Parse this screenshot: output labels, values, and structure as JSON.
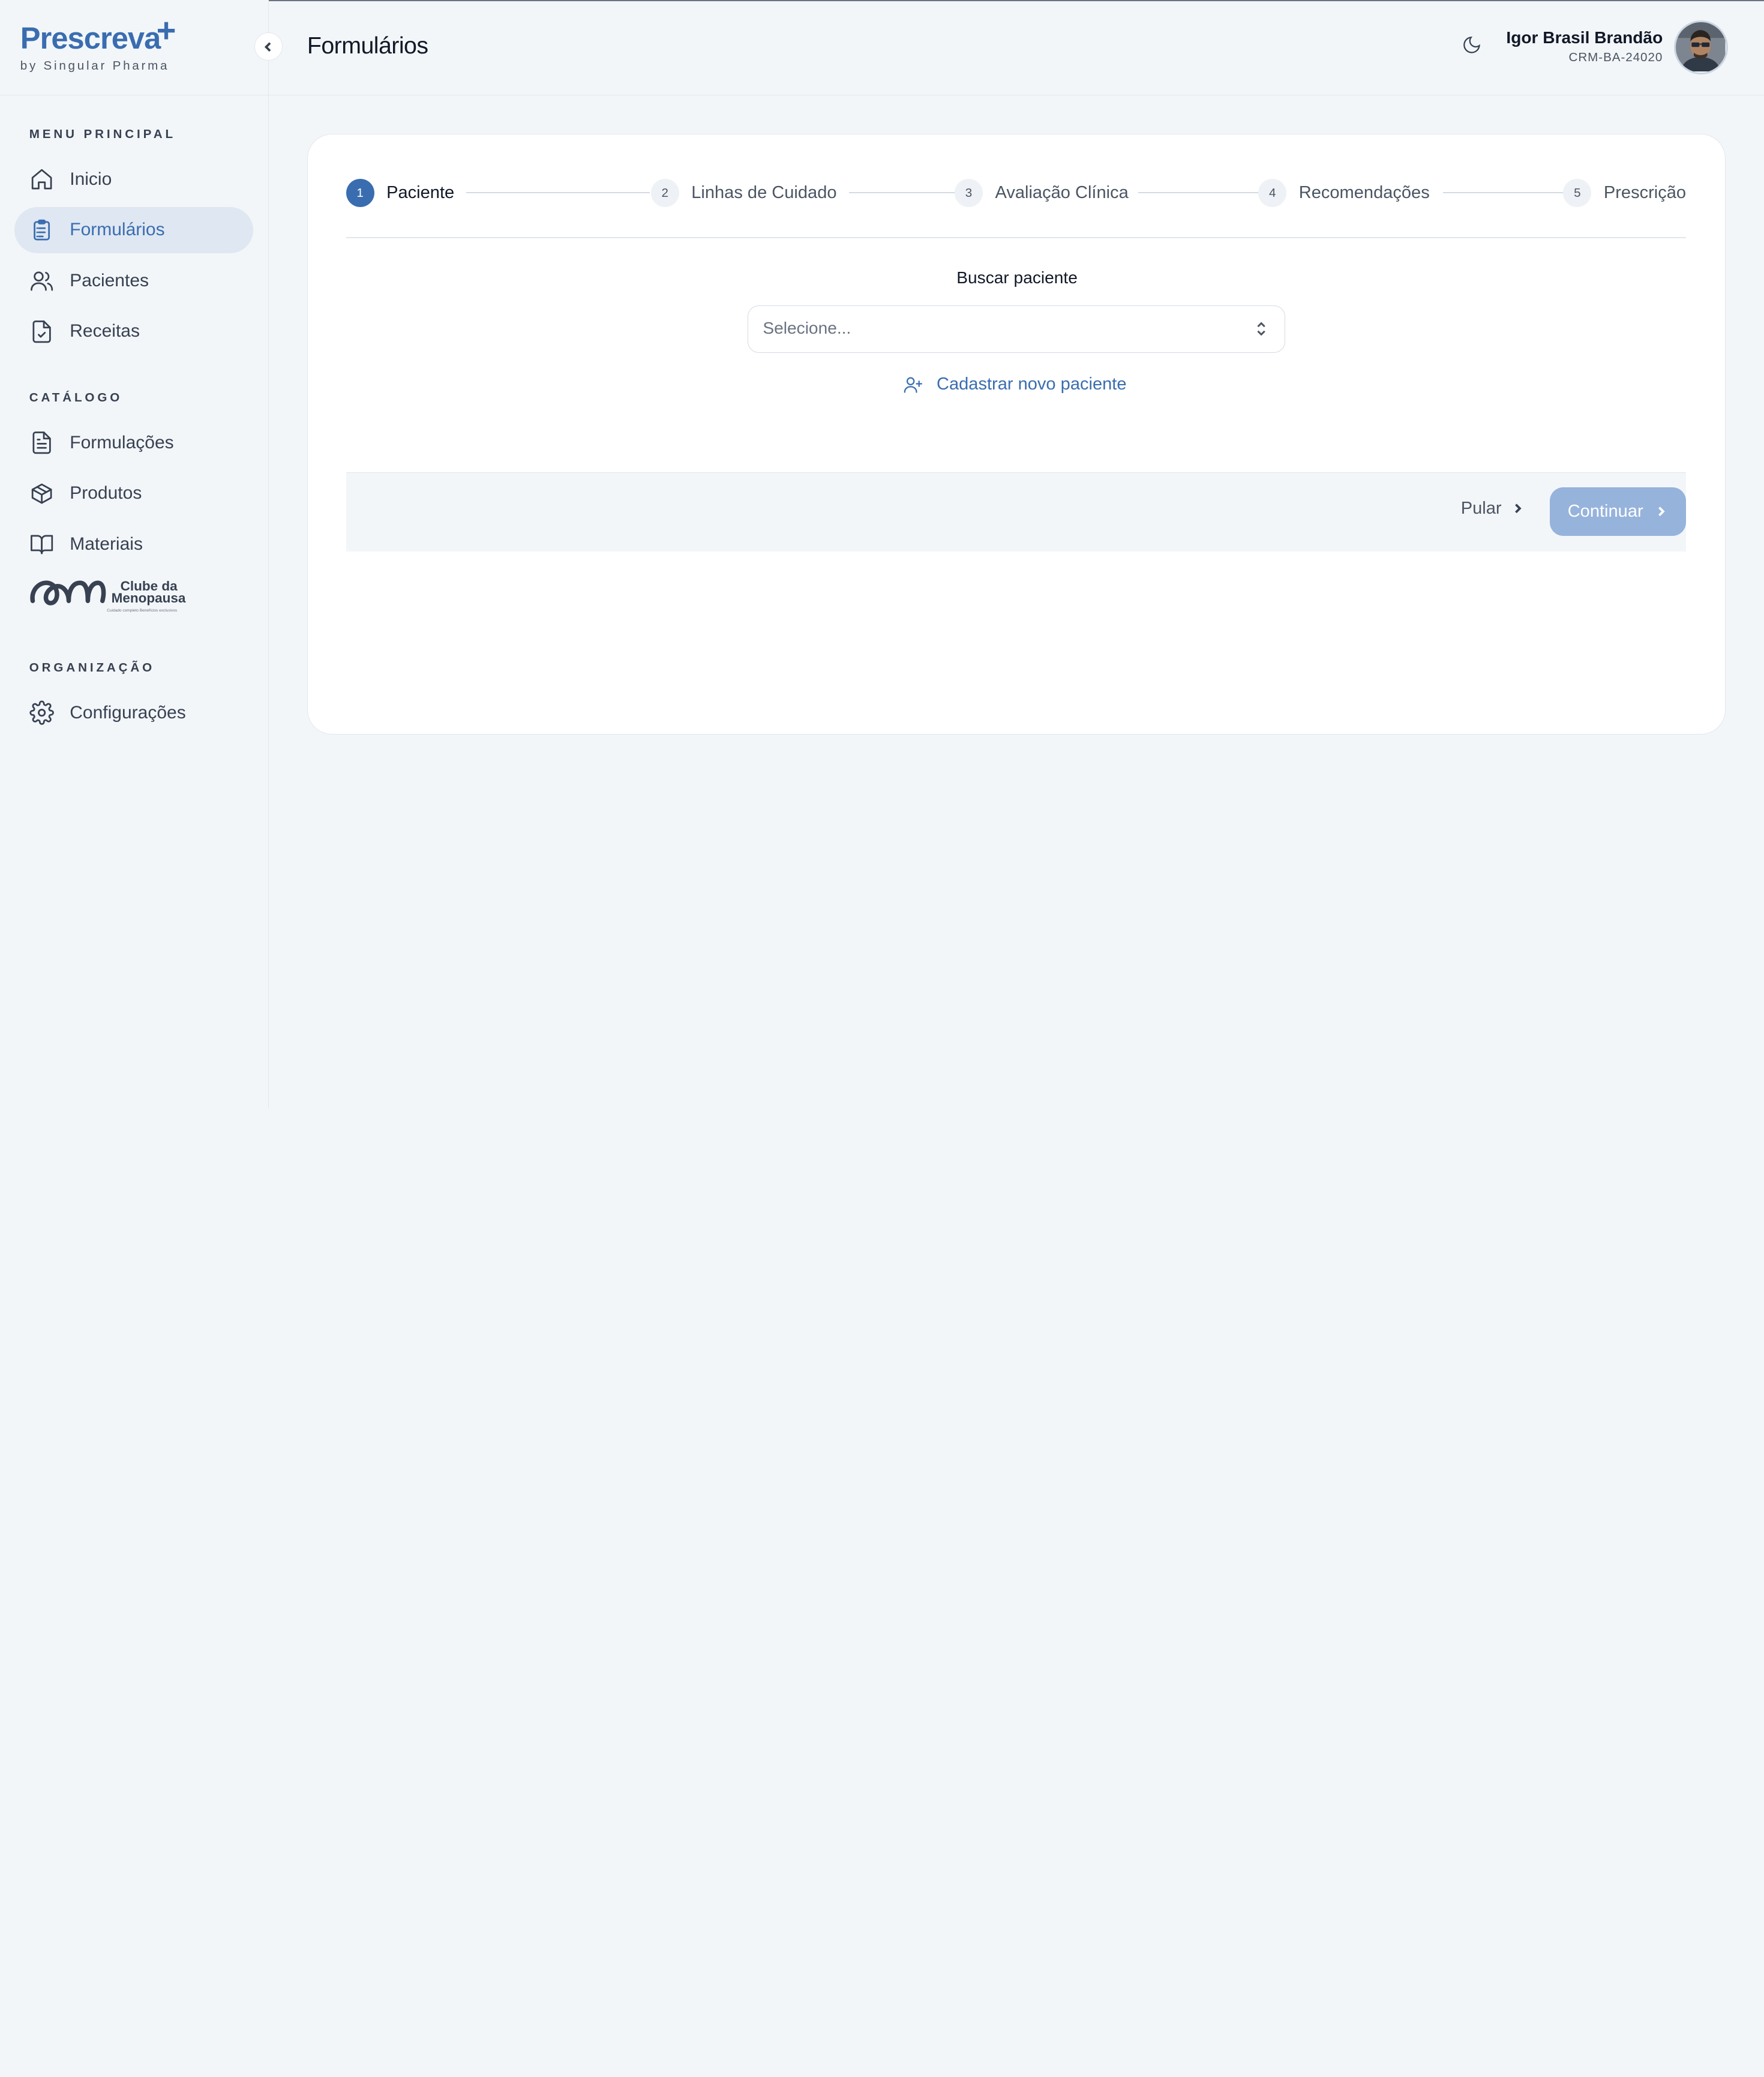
{
  "app": {
    "logo_text": "Prescreva",
    "logo_plus": "+",
    "logo_subtitle": "by Singular Pharma",
    "brand_color": "#3a6db0"
  },
  "sidebar": {
    "sections": [
      {
        "title": "MENU PRINCIPAL"
      },
      {
        "title": "CATÁLOGO"
      },
      {
        "title": "ORGANIZAÇÃO"
      }
    ],
    "items": [
      {
        "label": "Inicio",
        "icon": "home-icon"
      },
      {
        "label": "Formulários",
        "icon": "clipboard-list-icon",
        "active": true
      },
      {
        "label": "Pacientes",
        "icon": "users-icon"
      },
      {
        "label": "Receitas",
        "icon": "file-check-icon"
      },
      {
        "label": "Formulações",
        "icon": "file-text-icon"
      },
      {
        "label": "Produtos",
        "icon": "package-icon"
      },
      {
        "label": "Materiais",
        "icon": "book-open-icon"
      },
      {
        "label": "Configurações",
        "icon": "settings-icon"
      }
    ],
    "clube": {
      "line1": "Clube da",
      "line2": "Menopausa",
      "tagline": "Cuidado completo Benefícios exclusivos"
    }
  },
  "header": {
    "title": "Formulários",
    "theme_icon": "moon-icon",
    "user": {
      "name": "Igor Brasil Brandão",
      "crm": "CRM-BA-24020"
    }
  },
  "wizard": {
    "steps": [
      {
        "number": "1",
        "label": "Paciente",
        "active": true
      },
      {
        "number": "2",
        "label": "Linhas de Cuidado"
      },
      {
        "number": "3",
        "label": "Avaliação Clínica"
      },
      {
        "number": "4",
        "label": "Recomendações"
      },
      {
        "number": "5",
        "label": "Prescrição"
      }
    ],
    "search": {
      "label": "Buscar paciente",
      "placeholder": "Selecione..."
    },
    "new_patient_label": "Cadastrar novo paciente",
    "skip_label": "Pular",
    "continue_label": "Continuar"
  }
}
